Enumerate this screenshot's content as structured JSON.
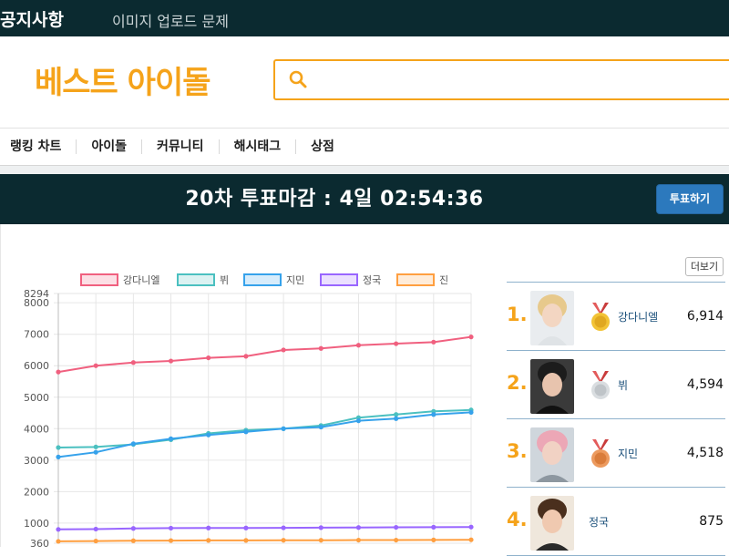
{
  "topbar": {
    "notice": "공지사항",
    "subtitle": "이미지 업로드 문제"
  },
  "header": {
    "logo": "베스트 아이돌",
    "search_placeholder": ""
  },
  "nav": {
    "items": [
      "랭킹 차트",
      "아이돌",
      "커뮤니티",
      "해시태그",
      "상점"
    ]
  },
  "vote": {
    "countdown": "20차 투표마감 : 4일 02:54:36",
    "button": "투표하기"
  },
  "ranking": {
    "more_label": "더보기",
    "items": [
      {
        "rank": "1.",
        "name": "강다니엘",
        "votes": "6,914",
        "medal": "gold"
      },
      {
        "rank": "2.",
        "name": "뷔",
        "votes": "4,594",
        "medal": "silver"
      },
      {
        "rank": "3.",
        "name": "지민",
        "votes": "4,518",
        "medal": "bronze"
      },
      {
        "rank": "4.",
        "name": "정국",
        "votes": "875",
        "medal": ""
      }
    ]
  },
  "colors": {
    "accent": "#f5a31a",
    "dark": "#0b2a30",
    "button": "#2c79bd"
  },
  "chart_data": {
    "type": "line",
    "x": [
      1,
      2,
      3,
      4,
      5,
      6,
      7,
      8,
      9,
      10,
      11,
      12
    ],
    "ylim": [
      360,
      8294
    ],
    "yticks": [
      "8294",
      "8000",
      "7000",
      "6000",
      "5000",
      "4000",
      "3000",
      "2000",
      "1000",
      "360"
    ],
    "grid": true,
    "legend": "top",
    "series": [
      {
        "name": "강다니엘",
        "color": "#f0607f",
        "values": [
          5800,
          6000,
          6100,
          6150,
          6250,
          6300,
          6500,
          6550,
          6650,
          6700,
          6750,
          6914
        ]
      },
      {
        "name": "뷔",
        "color": "#4bc0c0",
        "values": [
          3400,
          3420,
          3500,
          3650,
          3850,
          3950,
          4000,
          4100,
          4350,
          4450,
          4550,
          4594
        ]
      },
      {
        "name": "지민",
        "color": "#36a2eb",
        "values": [
          3100,
          3250,
          3520,
          3680,
          3800,
          3900,
          4000,
          4050,
          4250,
          4320,
          4450,
          4518
        ]
      },
      {
        "name": "정국",
        "color": "#9966ff",
        "values": [
          800,
          810,
          830,
          840,
          845,
          845,
          850,
          855,
          860,
          865,
          870,
          875
        ]
      },
      {
        "name": "진",
        "color": "#ff9f40",
        "values": [
          420,
          430,
          440,
          445,
          450,
          450,
          455,
          455,
          460,
          460,
          465,
          470
        ]
      }
    ]
  }
}
